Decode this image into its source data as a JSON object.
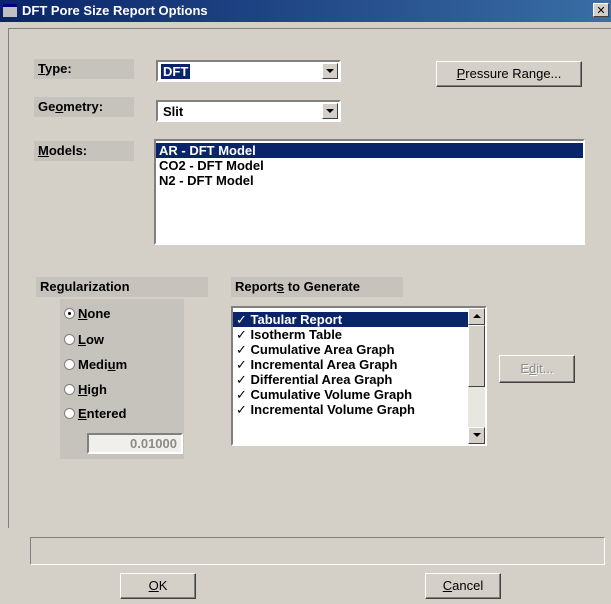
{
  "window": {
    "title": "DFT Pore Size Report Options",
    "close_glyph": "✕"
  },
  "type": {
    "label_pre": "",
    "label_key": "T",
    "label_post": "ype:",
    "value": "DFT"
  },
  "geometry": {
    "label_pre": "Ge",
    "label_key": "o",
    "label_post": "metry:",
    "value": "Slit"
  },
  "models": {
    "label_pre": "",
    "label_key": "M",
    "label_post": "odels:",
    "items": [
      "AR - DFT Model",
      "CO2 - DFT Model",
      "N2 - DFT Model"
    ],
    "selected_index": 0
  },
  "pressure_range_button": {
    "pre": "",
    "key": "P",
    "post": "ressure Range..."
  },
  "regularization": {
    "title": "Regularization",
    "options": [
      {
        "pre": "",
        "key": "N",
        "post": "one",
        "checked": true
      },
      {
        "pre": "",
        "key": "L",
        "post": "ow",
        "checked": false
      },
      {
        "pre": "Medi",
        "key": "u",
        "post": "m",
        "checked": false
      },
      {
        "pre": "",
        "key": "H",
        "post": "igh",
        "checked": false
      },
      {
        "pre": "",
        "key": "E",
        "post": "ntered",
        "checked": false
      }
    ],
    "entered_value": "0.01000"
  },
  "reports": {
    "title_pre": "Report",
    "title_key": "s",
    "title_post": " to Generate",
    "check_glyph": "✓",
    "items": [
      "Tabular Report",
      "Isotherm Table",
      "Cumulative Area Graph",
      "Incremental Area Graph",
      "Differential Area Graph",
      "Cumulative Volume Graph",
      "Incremental Volume Graph"
    ],
    "selected_index": 0
  },
  "edit_button": {
    "pre": "E",
    "key": "d",
    "post": "it..."
  },
  "ok_button": {
    "pre": "",
    "key": "O",
    "post": "K"
  },
  "cancel_button": {
    "pre": "",
    "key": "C",
    "post": "ancel"
  },
  "colors": {
    "titlebar_start": "#0a246a",
    "titlebar_end": "#3a6ea5",
    "face": "#d4d0c8",
    "selection": "#0a246a"
  }
}
